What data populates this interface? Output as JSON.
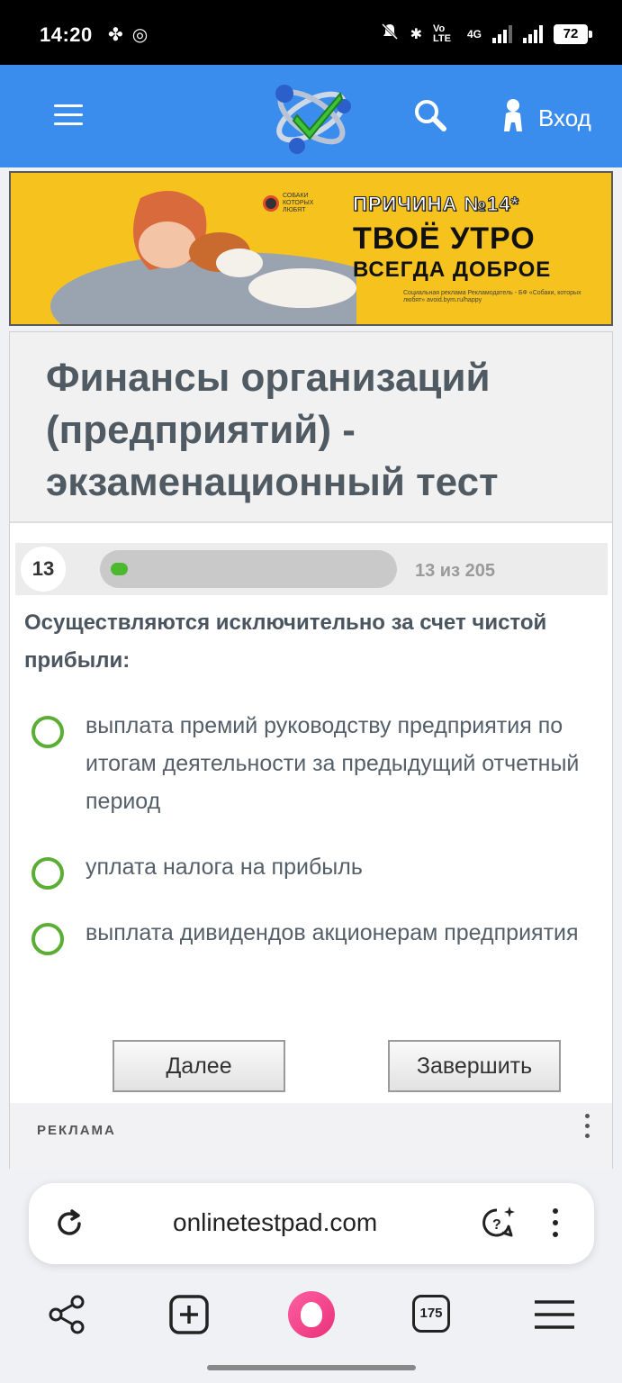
{
  "status_bar": {
    "time": "14:20",
    "network": "4G",
    "volte": "Vo LTE",
    "battery": "72"
  },
  "header": {
    "login_label": "Вход"
  },
  "banner": {
    "reason": "ПРИЧИНА №14*",
    "line1": "ТВОЁ УТРО",
    "line2": "ВСЕГДА ДОБРОЕ",
    "badge": "СОБАКИ КОТОРЫХ ЛЮБЯТ",
    "small": "Социальная реклама Рекламодатель - БФ «Собаки, которых любят» avoid.bym.ru/happy"
  },
  "test": {
    "title": "Финансы организаций (предприятий) - экзаменационный тест",
    "question_number": "13",
    "progress_text": "13 из 205",
    "progress_fraction": 0.063,
    "question": "Осуществляются исключительно за счет чистой прибыли:",
    "options": [
      "выплата премий руководству предприятия по итогам деятельности за предыдущий отчетный период",
      "уплата налога на прибыль",
      "выплата дивидендов акционерам предприятия"
    ],
    "next_label": "Далее",
    "finish_label": "Завершить",
    "ad_label": "РЕКЛАМА"
  },
  "browser": {
    "url": "onlinetestpad.com",
    "tabs_count": "175"
  },
  "colors": {
    "header_blue": "#3b8ded",
    "accent_green": "#5aae34",
    "banner_yellow": "#f6c21d",
    "alice_pink": "#e8327a"
  }
}
